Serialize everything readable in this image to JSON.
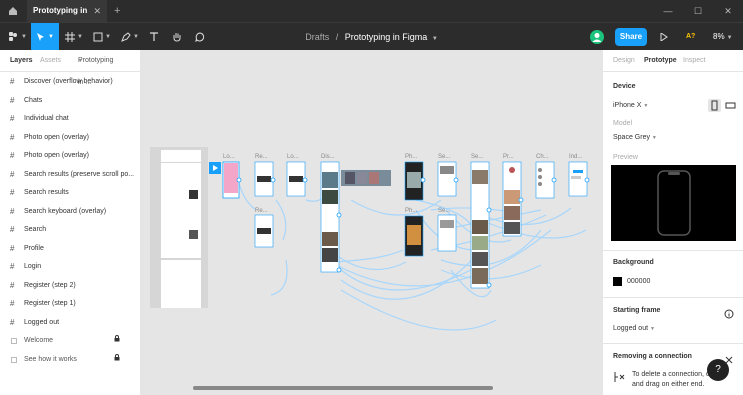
{
  "titlebar": {
    "tab_title": "Prototyping in Figma",
    "tab_close": "✕",
    "new_tab": "+",
    "win_min": "—",
    "win_max": "☐",
    "win_close": "✕"
  },
  "toolbar": {
    "breadcrumb_parent": "Drafts",
    "breadcrumb_sep": "/",
    "file_name": "Prototyping in Figma",
    "share_label": "Share",
    "a11y_badge": "A?",
    "zoom": "8%"
  },
  "left_panel": {
    "tabs": {
      "layers": "Layers",
      "assets": "Assets",
      "page": "Prototyping in ..."
    },
    "layers": [
      "Discover (overflow behavior)",
      "Chats",
      "Individual chat",
      "Photo open (overlay)",
      "Photo open (overlay)",
      "Search results (preserve scroll po...",
      "Search results",
      "Search keyboard (overlay)",
      "Search",
      "Profile",
      "Login",
      "Register (step 2)",
      "Register (step 1)",
      "Logged out"
    ],
    "locked_layers": [
      "Welcome",
      "See how it works"
    ]
  },
  "canvas": {
    "frame_labels": [
      "Lo...",
      "Re...",
      "Lo...",
      "Dis...",
      "Ph...",
      "Se...",
      "Se...",
      "Pr...",
      "Ch...",
      "Ind...",
      "Re...",
      "Ph...",
      "Se...",
      "Se..."
    ]
  },
  "right_panel": {
    "tabs": {
      "design": "Design",
      "prototype": "Prototype",
      "inspect": "Inspect"
    },
    "device_heading": "Device",
    "device_value": "iPhone X",
    "model_label": "Model",
    "model_value": "Space Grey",
    "preview_label": "Preview",
    "background_heading": "Background",
    "background_hex": "000000",
    "starting_frame_heading": "Starting frame",
    "starting_frame_value": "Logged out",
    "removing_heading": "Removing a connection",
    "removing_text": "To delete a connection, click and drag on either end."
  },
  "colors": {
    "accent": "#18a0fb",
    "canvas": "#e5e5e5",
    "chrome": "#2c2c2c",
    "connection": "#a8d6fb"
  },
  "icons": {
    "home": "home-icon",
    "main_menu": "figma-menu-icon",
    "move": "move-icon",
    "frame": "frame-icon",
    "shape": "rectangle-icon",
    "pen": "pen-icon",
    "text": "text-icon",
    "hand": "hand-icon",
    "comment": "comment-icon",
    "play": "play-icon"
  }
}
